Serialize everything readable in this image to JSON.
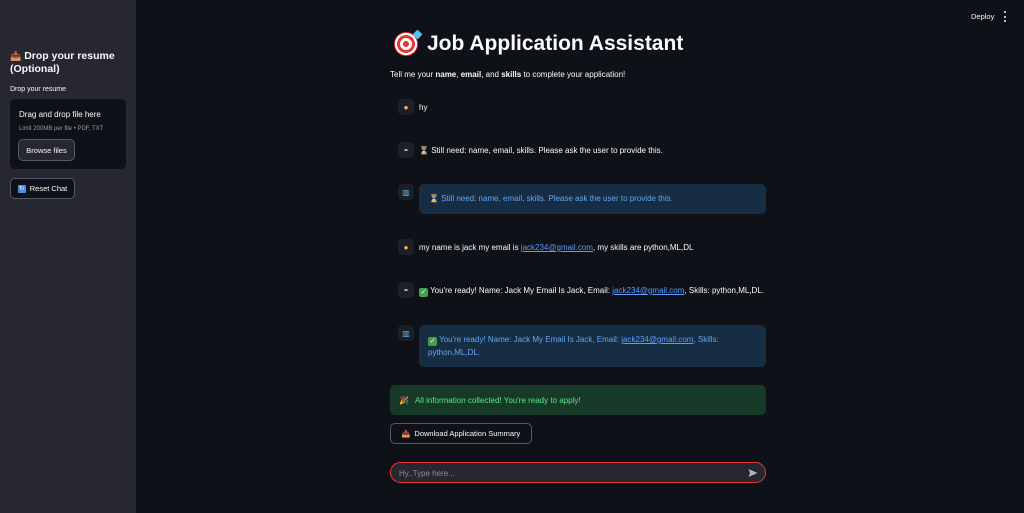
{
  "sidebar": {
    "title": "Drop your resume (Optional)",
    "uploader_label": "Drop your resume",
    "drop_text": "Drag and drop file here",
    "limit_text": "Limit 200MB per file • PDF, TXT",
    "browse_label": "Browse files",
    "reset_label": "Reset Chat"
  },
  "header": {
    "deploy_label": "Deploy"
  },
  "main": {
    "title": "Job Application Assistant",
    "intro_prefix": "Tell me your ",
    "intro_name": "name",
    "intro_sep1": ", ",
    "intro_email": "email",
    "intro_sep2": ", and ",
    "intro_skills": "skills",
    "intro_suffix": " to complete your application!"
  },
  "messages": {
    "m1": {
      "text": "hy"
    },
    "m2": {
      "text": "Still need: name, email, skills. Please ask the user to provide this."
    },
    "m3": {
      "text": "Still need: name, email, skills. Please ask the user to provide this."
    },
    "m4": {
      "prefix": "my name is jack my email is ",
      "email": "jack234@gmail.com",
      "suffix": ", my skills are python,ML,DL"
    },
    "m5": {
      "prefix": "You're ready! Name: Jack My Email Is Jack, Email: ",
      "email": "jack234@gmail.com",
      "suffix": ", Skills: python,ML,DL."
    },
    "m6": {
      "prefix": "You're ready! Name: Jack My Email Is Jack, Email: ",
      "email": "jack234@gmail.com",
      "suffix": ", Skills:",
      "line2": "python,ML,DL."
    }
  },
  "success_text": "All information collected! You're ready to apply!",
  "download_label": "Download Application Summary",
  "chat_input": {
    "value": "Hy..Type here...",
    "placeholder": "Hy..Type here..."
  },
  "colors": {
    "background": "#0e1117",
    "sidebar": "#262730",
    "info_bg": "#172d43",
    "info_text": "#61a6f2",
    "success_bg": "#173928",
    "success_text": "#5ce488",
    "input_border": "#e53935"
  },
  "icons": [
    "inbox-tray-icon",
    "reset-icon",
    "target-icon",
    "user-avatar-icon",
    "bot-avatar-icon",
    "chart-icon",
    "hourglass-icon",
    "check-icon",
    "party-popper-icon",
    "send-icon",
    "kebab-menu-icon"
  ]
}
